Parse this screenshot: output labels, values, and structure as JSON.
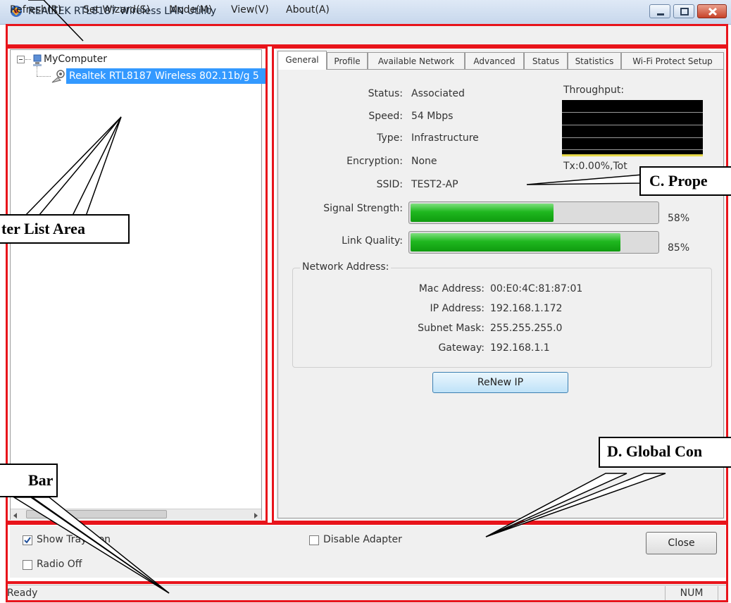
{
  "window": {
    "title": "REALTEK RTL8187 Wireless LAN Utility"
  },
  "menu": [
    "Refresh(R)",
    "Set Wizard(S)",
    "Mode(M)",
    "View(V)",
    "About(A)"
  ],
  "tree": {
    "root": "MyComputer",
    "adapter": "Realtek RTL8187 Wireless 802.11b/g 5"
  },
  "tabs": [
    "General",
    "Profile",
    "Available Network",
    "Advanced",
    "Status",
    "Statistics",
    "Wi-Fi Protect Setup"
  ],
  "general": {
    "status_label": "Status:",
    "status_value": "Associated",
    "speed_label": "Speed:",
    "speed_value": "54 Mbps",
    "type_label": "Type:",
    "type_value": "Infrastructure",
    "encryption_label": "Encryption:",
    "encryption_value": "None",
    "ssid_label": "SSID:",
    "ssid_value": "TEST2-AP",
    "throughput_label": "Throughput:",
    "throughput_text": "Tx:0.00%,Tot",
    "signal_label": "Signal Strength:",
    "signal_percent": 58,
    "signal_text": "58%",
    "link_label": "Link Quality:",
    "link_percent": 85,
    "link_text": "85%",
    "network_address_label": "Network Address:",
    "mac_label": "Mac Address:",
    "mac_value": "00:E0:4C:81:87:01",
    "ip_label": "IP Address:",
    "ip_value": "192.168.1.172",
    "subnet_label": "Subnet Mask:",
    "subnet_value": "255.255.255.0",
    "gateway_label": "Gateway:",
    "gateway_value": "192.168.1.1",
    "renew_button": "ReNew IP"
  },
  "global": {
    "show_tray_icon_label": "Show Tray Icon",
    "show_tray_icon_checked": true,
    "radio_off_label": "Radio Off",
    "radio_off_checked": false,
    "disable_adapter_label": "Disable Adapter",
    "disable_adapter_checked": false,
    "close_button": "Close"
  },
  "statusbar": {
    "text": "Ready",
    "num": "NUM"
  },
  "annotations": {
    "adapter_list": "ter List Area",
    "properties": "C. Prope",
    "global_control": "D. Global Con",
    "status_bar": "Bar"
  },
  "colors": {
    "annotation_frame": "#e8141b",
    "selection": "#3399ff",
    "bar_fill": "#1fb71f"
  }
}
